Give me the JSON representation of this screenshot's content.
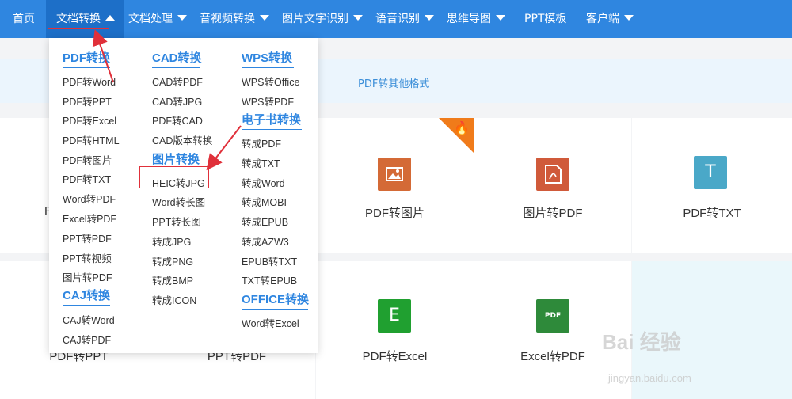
{
  "nav": {
    "home": "首页",
    "doc_convert": "文档转换",
    "doc_process": "文档处理",
    "av_convert": "音视频转换",
    "ocr": "图片文字识别",
    "speech": "语音识别",
    "mindmap": "思维导图",
    "ppt_template": "PPT模板",
    "client": "客户端"
  },
  "subbar": {
    "link": "PDF转其他格式"
  },
  "tiles": {
    "pdf_to_image": "PDF转图片",
    "image_to_pdf": "图片转PDF",
    "pdf_to_txt": "PDF转TXT",
    "pdf_to_excel": "PDF转Excel",
    "excel_to_pdf": "Excel转PDF",
    "partial_left_top": "P",
    "partial_left_bottom": "PDF转PPT",
    "partial_mid_bottom": "PPT转PDF",
    "icon_txt": "T",
    "icon_excel": "E",
    "icon_pdf": "PDF"
  },
  "dropdown": {
    "col1": {
      "head1": "PDF转换",
      "items1": [
        "PDF转Word",
        "PDF转PPT",
        "PDF转Excel",
        "PDF转HTML",
        "PDF转图片",
        "PDF转TXT",
        "Word转PDF",
        "Excel转PDF",
        "PPT转PDF",
        "PPT转视频",
        "图片转PDF"
      ],
      "head2": "CAJ转换",
      "items2": [
        "CAJ转Word",
        "CAJ转PDF"
      ]
    },
    "col2": {
      "head1": "CAD转换",
      "items1": [
        "CAD转PDF",
        "CAD转JPG",
        "PDF转CAD",
        "CAD版本转换"
      ],
      "head2": "图片转换",
      "items2": [
        "HEIC转JPG",
        "Word转长图",
        "PPT转长图",
        "转成JPG",
        "转成PNG",
        "转成BMP",
        "转成ICON"
      ]
    },
    "col3": {
      "head1": "WPS转换",
      "items1": [
        "WPS转Office",
        "WPS转PDF"
      ],
      "head2": "电子书转换",
      "items2": [
        "转成PDF",
        "转成TXT",
        "转成Word",
        "转成MOBI",
        "转成EPUB",
        "转成AZW3",
        "EPUB转TXT",
        "TXT转EPUB"
      ],
      "head3": "OFFICE转换",
      "items3": [
        "Word转Excel"
      ]
    }
  },
  "watermark": {
    "main": "Bai 经验",
    "sub": "jingyan.baidu.com"
  },
  "colors": {
    "nav": "#2f86e0",
    "accent": "#e0303a",
    "hot": "#f07b1a"
  }
}
